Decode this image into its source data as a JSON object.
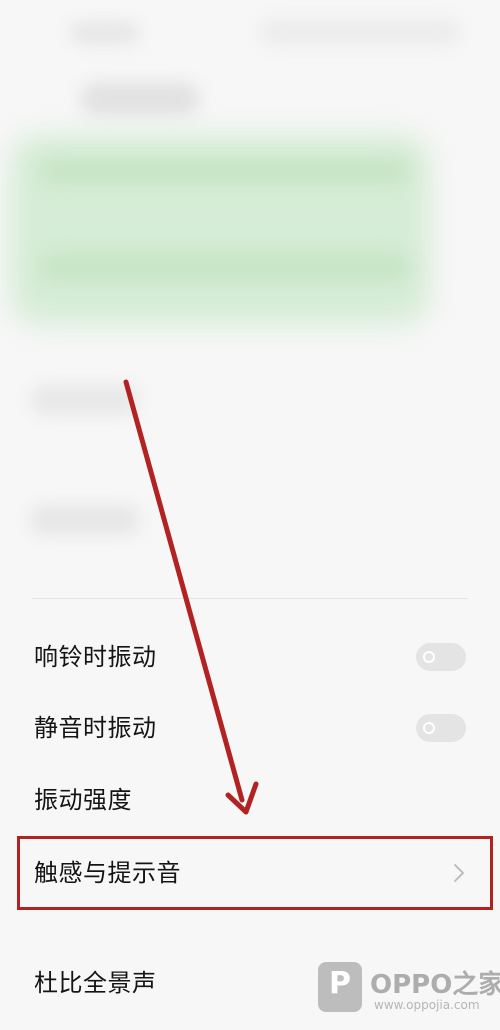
{
  "settings": {
    "items": [
      {
        "label": "响铃时振动",
        "control": "toggle",
        "state": "off"
      },
      {
        "label": "静音时振动",
        "control": "toggle",
        "state": "off"
      },
      {
        "label": "振动强度",
        "control": "none"
      },
      {
        "label": "触感与提示音",
        "control": "chevron",
        "highlighted": true
      },
      {
        "label": "杜比全景声",
        "control": "none"
      }
    ]
  },
  "annotation": {
    "color": "#b32222",
    "target": "触感与提示音"
  },
  "watermark": {
    "logo_letter": "P",
    "title": "OPPO之家",
    "url": "www.oppojia.com"
  }
}
